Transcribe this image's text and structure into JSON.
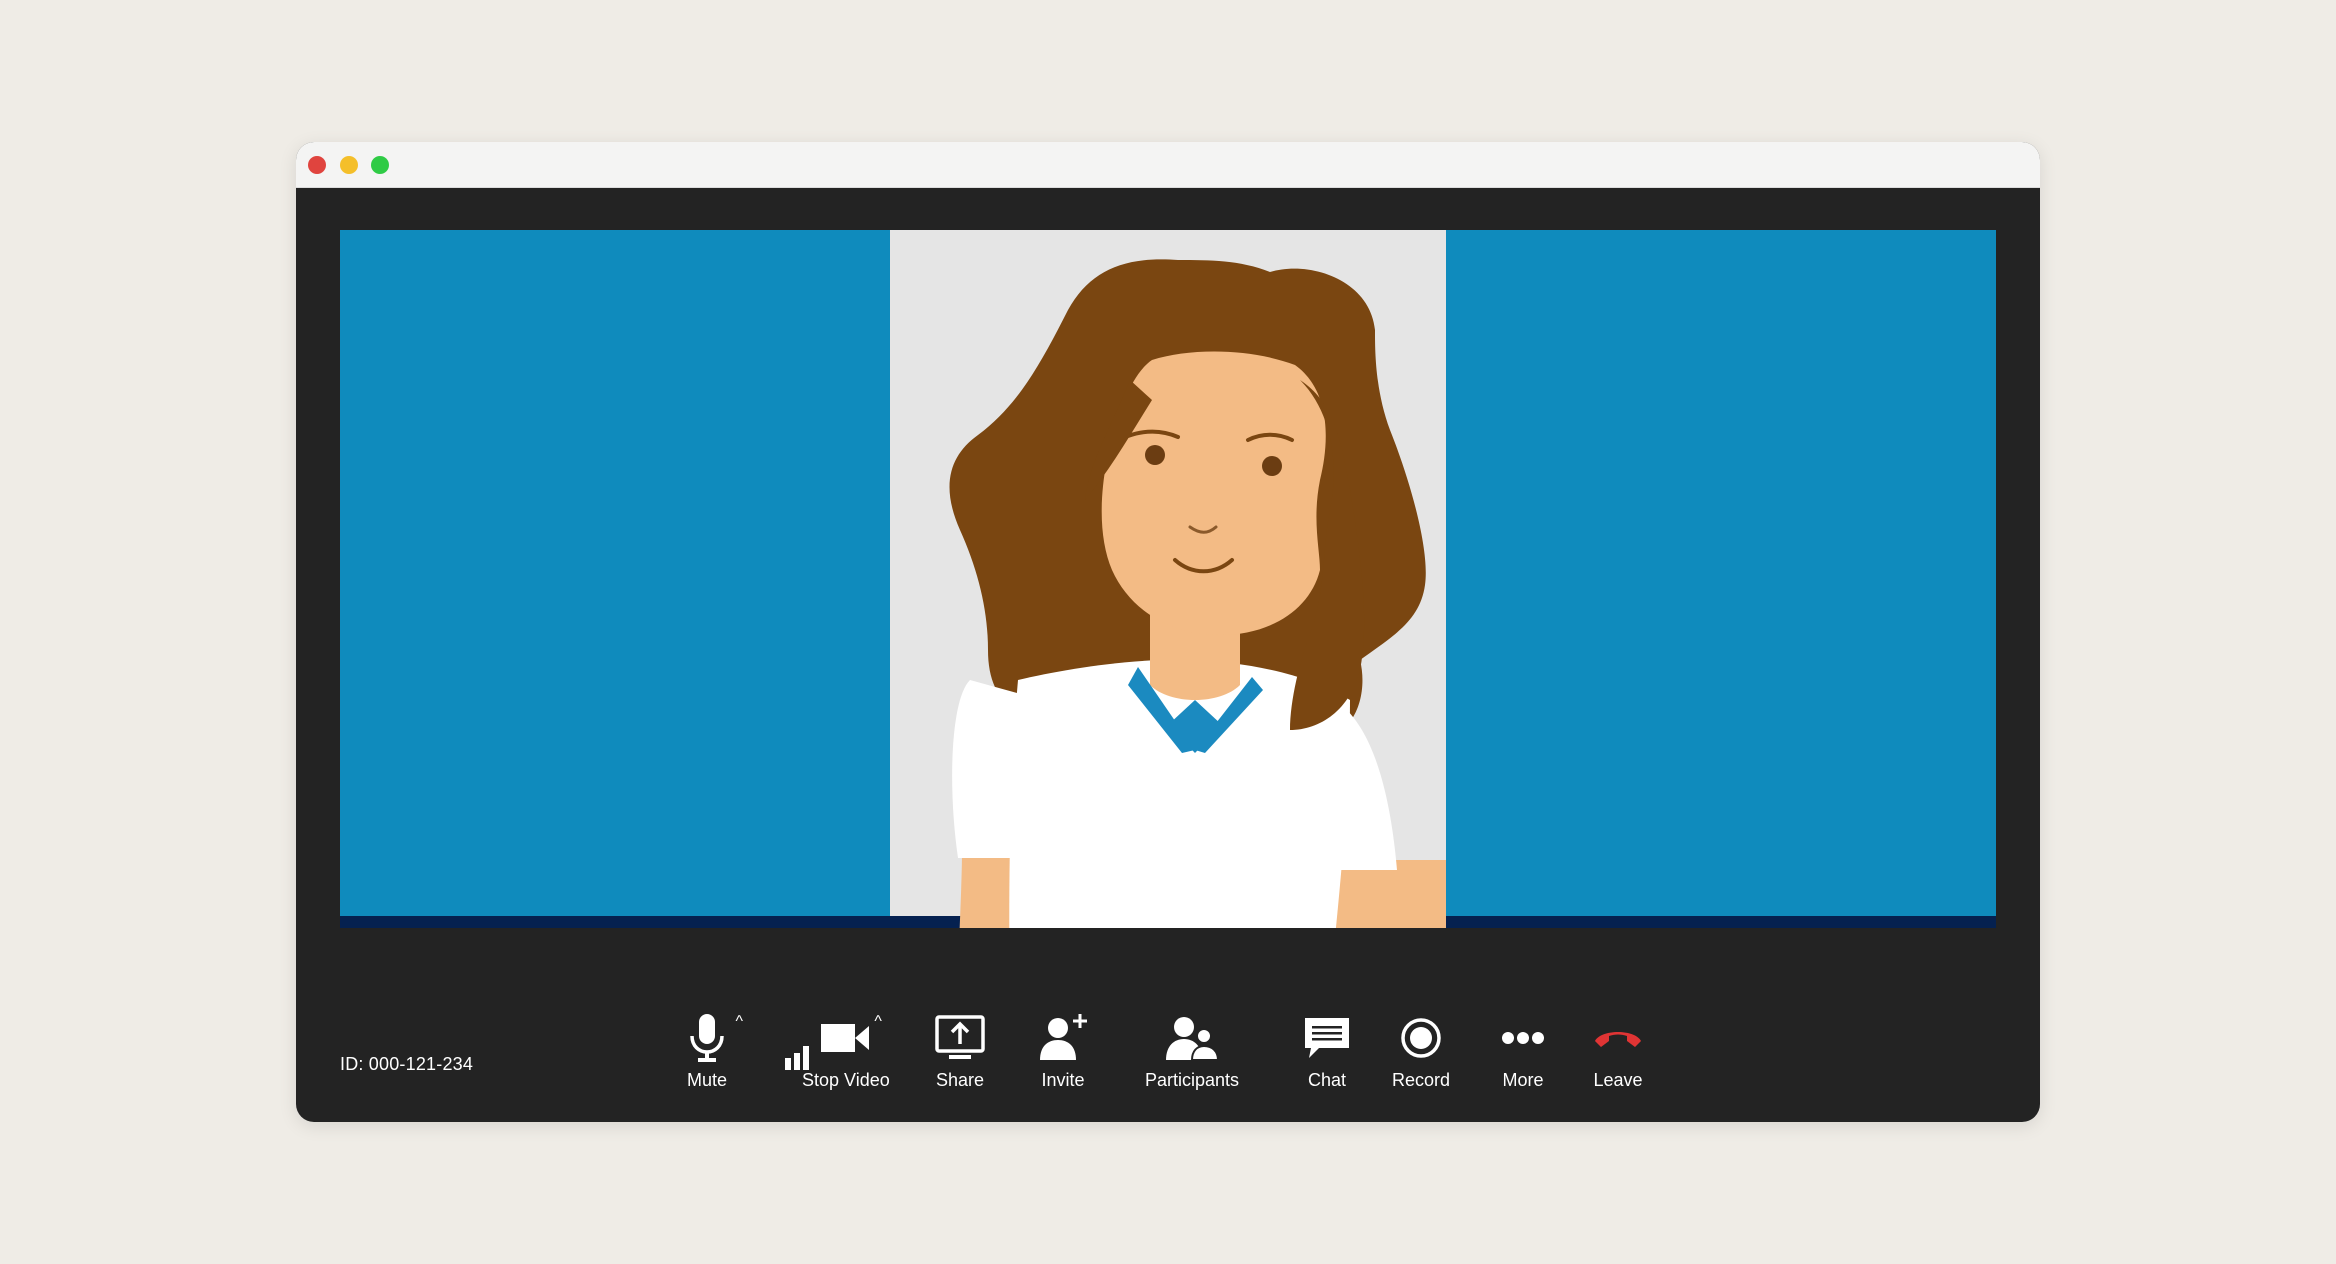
{
  "window": {
    "traffic_lights": {
      "close_color": "#e0443e",
      "minimize_color": "#f4bf2a",
      "maximize_color": "#2fcb45"
    }
  },
  "video": {
    "panel_blue_color": "#0f8bbd",
    "panel_center_color": "#e5e5e5",
    "floor_color": "#052150",
    "participant": {
      "hair_color": "#7a4611",
      "skin_color": "#f3bb85",
      "shirt_color": "#ffffff",
      "collar_color": "#1b8ac0"
    }
  },
  "status": {
    "meeting_id": "ID: 000-121-234",
    "signal_icon": "signal-bars-icon"
  },
  "toolbar": {
    "items": [
      {
        "label": "Mute",
        "icon": "microphone-icon"
      },
      {
        "label": "Stop Video",
        "icon": "video-camera-icon"
      },
      {
        "label": "Share",
        "icon": "share-screen-icon"
      },
      {
        "label": "Invite",
        "icon": "add-person-icon"
      },
      {
        "label": "Participants",
        "icon": "participants-icon"
      },
      {
        "label": "Chat",
        "icon": "chat-icon"
      },
      {
        "label": "Record",
        "icon": "record-icon"
      },
      {
        "label": "More",
        "icon": "more-dots-icon"
      },
      {
        "label": "Leave",
        "icon": "hang-up-icon"
      }
    ],
    "leave_color": "#e03434",
    "caret_glyph": "^"
  }
}
